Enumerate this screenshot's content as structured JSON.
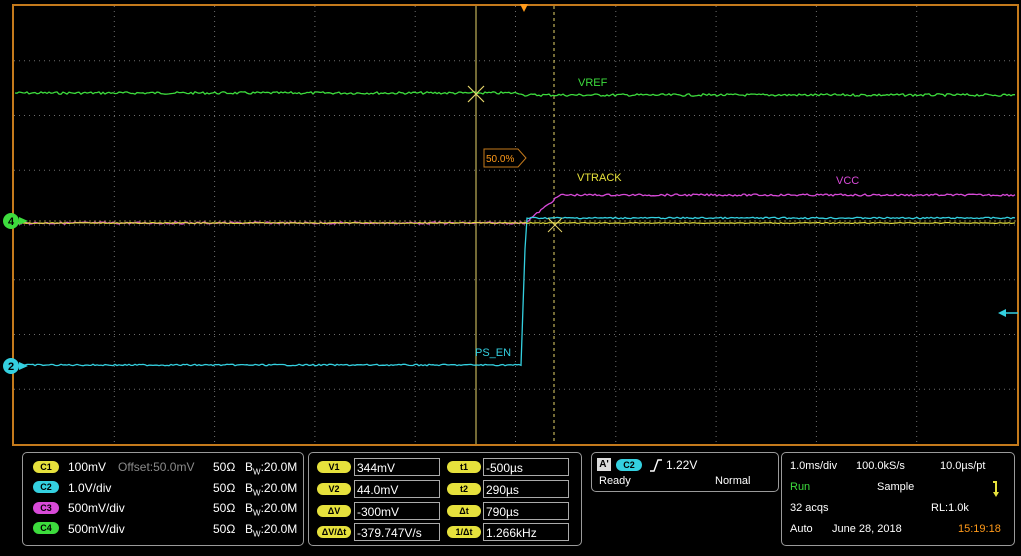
{
  "colors": {
    "frame": "#c47a1c",
    "grid": "#6e6e6e",
    "ch1": "#e6e13c",
    "ch2": "#34d0e0",
    "ch3": "#d94ad9",
    "ch4": "#3ddc3d",
    "cursor": "#e6d56a",
    "trigger": "#ff9a1a"
  },
  "waveform_labels": {
    "vref": "VREF",
    "vtrack": "VTRACK",
    "vcc": "VCC",
    "ps_en": "PS_EN",
    "trigger_level": "50.0%"
  },
  "channel_markers": {
    "ch4": "4",
    "ch2": "2"
  },
  "channels": [
    {
      "id": "C1",
      "scale": "100mV",
      "offset": "Offset:50.0mV",
      "impedance": "50Ω",
      "bw_prefix": "B",
      "bw_sub": "W",
      "bw": ":20.0M",
      "color": "#e6e13c"
    },
    {
      "id": "C2",
      "scale": "1.0V/div",
      "offset": "",
      "impedance": "50Ω",
      "bw_prefix": "B",
      "bw_sub": "W",
      "bw": ":20.0M",
      "color": "#34d0e0"
    },
    {
      "id": "C3",
      "scale": "500mV/div",
      "offset": "",
      "impedance": "50Ω",
      "bw_prefix": "B",
      "bw_sub": "W",
      "bw": ":20.0M",
      "color": "#d94ad9"
    },
    {
      "id": "C4",
      "scale": "500mV/div",
      "offset": "",
      "impedance": "50Ω",
      "bw_prefix": "B",
      "bw_sub": "W",
      "bw": ":20.0M",
      "color": "#3ddc3d"
    }
  ],
  "cursors": {
    "v1_label": "V1",
    "v1": "344mV",
    "v2_label": "V2",
    "v2": "44.0mV",
    "dv_label": "ΔV",
    "dv": "-300mV",
    "dvdt_label": "ΔV/Δt",
    "dvdt": "-379.747V/s",
    "t1_label": "t1",
    "t1": "-500µs",
    "t2_label": "t2",
    "t2": "290µs",
    "dt_label": "Δt",
    "dt": "790µs",
    "inv_dt_label": "1/Δt",
    "inv_dt": "1.266kHz"
  },
  "trigger": {
    "mode_badge": "A'",
    "source": "C2",
    "slope_icon": "rising-edge-icon",
    "level": "1.22V",
    "status": "Ready",
    "type": "Normal"
  },
  "acquisition": {
    "timebase": "1.0ms/div",
    "sample_rate": "100.0kS/s",
    "resolution": "10.0µs/pt",
    "state": "Run",
    "mode": "Sample",
    "acqs": "32 acqs",
    "record_length": "RL:1.0k",
    "trigger_mode": "Auto",
    "date": "June 28, 2018",
    "time": "15:19:18"
  }
}
